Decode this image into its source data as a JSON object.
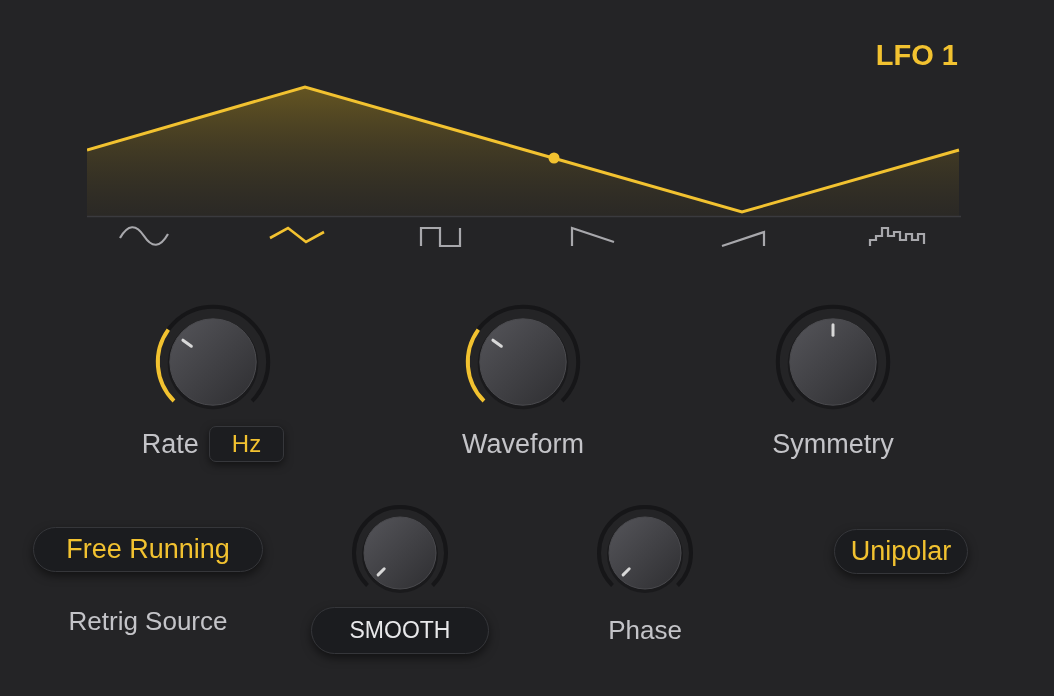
{
  "header": {
    "title": "LFO 1"
  },
  "waveforms": [
    {
      "kind": "sine",
      "selected": false
    },
    {
      "kind": "triangle",
      "selected": true
    },
    {
      "kind": "square",
      "selected": false
    },
    {
      "kind": "saw-down",
      "selected": false
    },
    {
      "kind": "saw-up",
      "selected": false
    },
    {
      "kind": "random",
      "selected": false
    }
  ],
  "knobs": [
    {
      "label": "Rate",
      "unit": "Hz"
    },
    {
      "label": "Waveform"
    },
    {
      "label": "Symmetry"
    }
  ],
  "retrig": {
    "value": "Free Running",
    "label": "Retrig Source"
  },
  "smooth": {
    "button": "SMOOTH"
  },
  "phase": {
    "label": "Phase"
  },
  "polarity": {
    "value": "Unipolar"
  }
}
